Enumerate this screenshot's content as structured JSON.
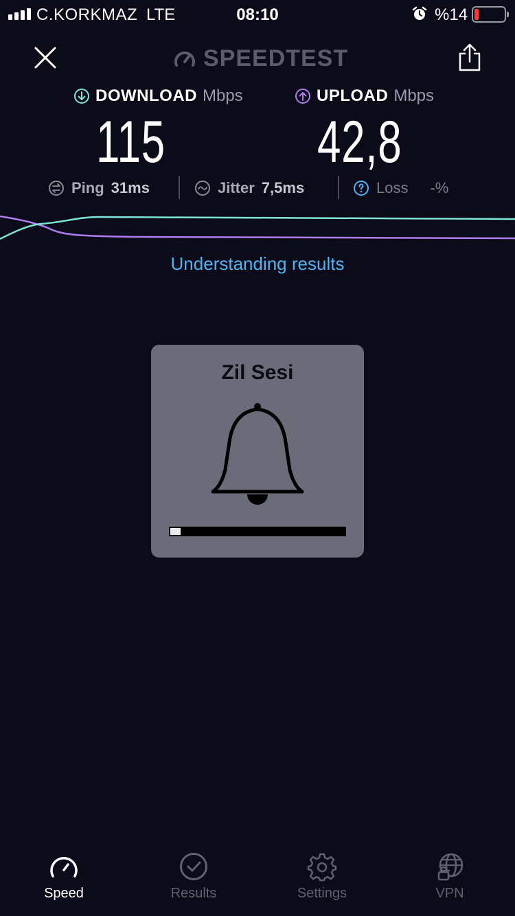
{
  "status_bar": {
    "carrier": "C.KORKMAZ",
    "network": "LTE",
    "time": "08:10",
    "battery_percent": "%14",
    "battery_level": 0.14,
    "battery_color": "#ff3b30",
    "icons": [
      "signal-icon",
      "alarm-icon",
      "battery-icon"
    ]
  },
  "header": {
    "brand": "SPEEDTEST",
    "icons": [
      "close-icon",
      "speedometer-icon",
      "share-icon"
    ]
  },
  "metrics": {
    "download": {
      "label": "DOWNLOAD",
      "unit": "Mbps",
      "value": "115",
      "color": "#7ee6d8"
    },
    "upload": {
      "label": "UPLOAD",
      "unit": "Mbps",
      "value": "42,8",
      "color": "#b07cf2"
    }
  },
  "stats": {
    "ping": {
      "label": "Ping",
      "value": "31ms"
    },
    "jitter": {
      "label": "Jitter",
      "value": "7,5ms"
    },
    "loss": {
      "label": "Loss",
      "value": "-%"
    }
  },
  "link": {
    "understanding": "Understanding results"
  },
  "ringer": {
    "title": "Zil Sesi",
    "volume_level": 0.06,
    "icon": "bell-icon"
  },
  "tabs": [
    {
      "label": "Speed",
      "icon": "speedometer-icon",
      "active": true
    },
    {
      "label": "Results",
      "icon": "check-circle-icon",
      "active": false
    },
    {
      "label": "Settings",
      "icon": "gear-icon",
      "active": false
    },
    {
      "label": "VPN",
      "icon": "globe-lock-icon",
      "active": false
    }
  ],
  "colors": {
    "background": "#0b0b19",
    "link": "#4eb4f4",
    "download_line": "#7ee6d8",
    "upload_line": "#b07cf2"
  }
}
